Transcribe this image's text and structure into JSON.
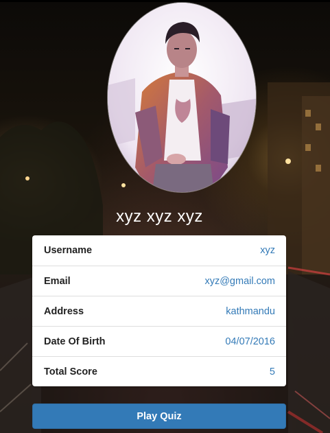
{
  "profile": {
    "name": "xyz xyz xyz",
    "avatar_icon": "user-photo"
  },
  "details": [
    {
      "label": "Username",
      "value": "xyz"
    },
    {
      "label": "Email",
      "value": "xyz@gmail.com"
    },
    {
      "label": "Address",
      "value": "kathmandu"
    },
    {
      "label": "Date Of Birth",
      "value": "04/07/2016"
    },
    {
      "label": "Total Score",
      "value": "5"
    }
  ],
  "actions": {
    "play_label": "Play Quiz"
  },
  "colors": {
    "accent": "#337ab7",
    "card_background": "#ffffff",
    "label_text": "#222222"
  }
}
